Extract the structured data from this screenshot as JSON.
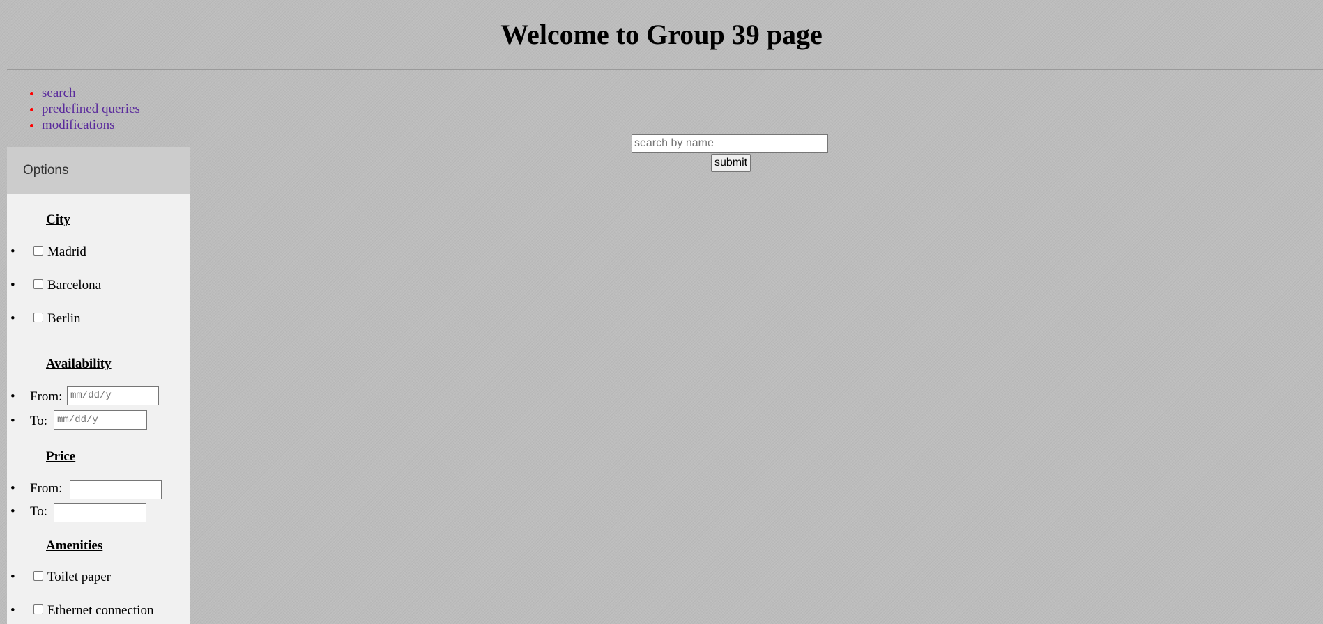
{
  "page": {
    "title": "Welcome to Group 39 page"
  },
  "nav": {
    "items": [
      {
        "label": "search"
      },
      {
        "label": "predefined queries"
      },
      {
        "label": "modifications"
      }
    ]
  },
  "sidebar": {
    "header": "Options",
    "city": {
      "title": "City",
      "options": [
        {
          "label": "Madrid",
          "checked": false
        },
        {
          "label": "Barcelona",
          "checked": false
        },
        {
          "label": "Berlin",
          "checked": false
        }
      ]
    },
    "availability": {
      "title": "Availability",
      "from_label": "From:",
      "from_placeholder": "mm/dd/y",
      "to_label": "To:",
      "to_placeholder": "mm/dd/y"
    },
    "price": {
      "title": "Price",
      "from_label": "From:",
      "from_value": "",
      "to_label": "To:",
      "to_value": ""
    },
    "amenities": {
      "title": "Amenities",
      "options": [
        {
          "label": "Toilet paper",
          "checked": false
        },
        {
          "label": "Ethernet connection",
          "checked": false
        }
      ]
    }
  },
  "search": {
    "placeholder": "search by name",
    "value": "",
    "submit_label": "submit"
  },
  "colors": {
    "background": "#bdbdbd",
    "sidebar_bg": "#f1f1f1",
    "sidebar_header_bg": "#cccccc",
    "link": "#5a2b9c",
    "nav_bullet": "#ff0000"
  }
}
